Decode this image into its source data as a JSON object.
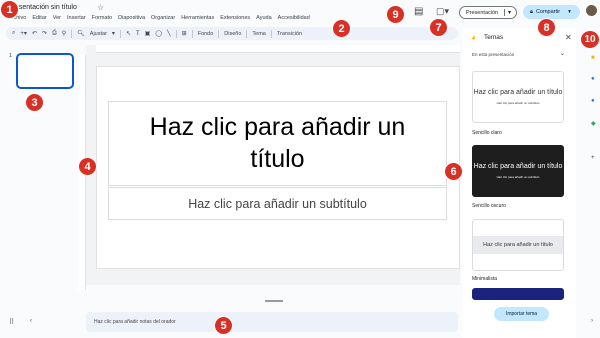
{
  "header": {
    "doc_title": "Presentación sin título",
    "menu": [
      "Archivo",
      "Editar",
      "Ver",
      "Insertar",
      "Formato",
      "Diapositiva",
      "Organizar",
      "Herramientas",
      "Extensiones",
      "Ayuda",
      "Accesibilidad"
    ],
    "present_label": "Presentación",
    "share_label": "Compartir"
  },
  "toolbar": {
    "fit_label": "Ajustar",
    "background_label": "Fondo",
    "layout_label": "Diseño",
    "theme_label": "Tema",
    "transition_label": "Transición"
  },
  "filmstrip": {
    "slide_number": "1"
  },
  "slide": {
    "title_placeholder": "Haz clic para añadir un título",
    "subtitle_placeholder": "Haz clic para añadir un subtítulo"
  },
  "notes": {
    "placeholder": "Haz clic para añadir notas del orador"
  },
  "themes_panel": {
    "title": "Temas",
    "dropdown": "En esta presentación",
    "cards": [
      {
        "title": "Haz clic para añadir un título",
        "subtitle": "Haz clic para añadir un subtítulo",
        "name": "Sencillo claro"
      },
      {
        "title": "Haz clic para añadir un título",
        "subtitle": "Haz clic para añadir un subtítulo",
        "name": "Sencillo oscuro"
      },
      {
        "title": "Haz clic para añadir un título",
        "subtitle": "",
        "name": "Minimalista"
      }
    ],
    "import_label": "Importar tema"
  },
  "markers": [
    "1",
    "2",
    "3",
    "4",
    "5",
    "6",
    "7",
    "8",
    "9",
    "10"
  ],
  "colors": {
    "accent": "#0b57d0",
    "share_bg": "#c2e7ff",
    "marker": "#d93025",
    "toolbar_bg": "#edf2fa"
  }
}
